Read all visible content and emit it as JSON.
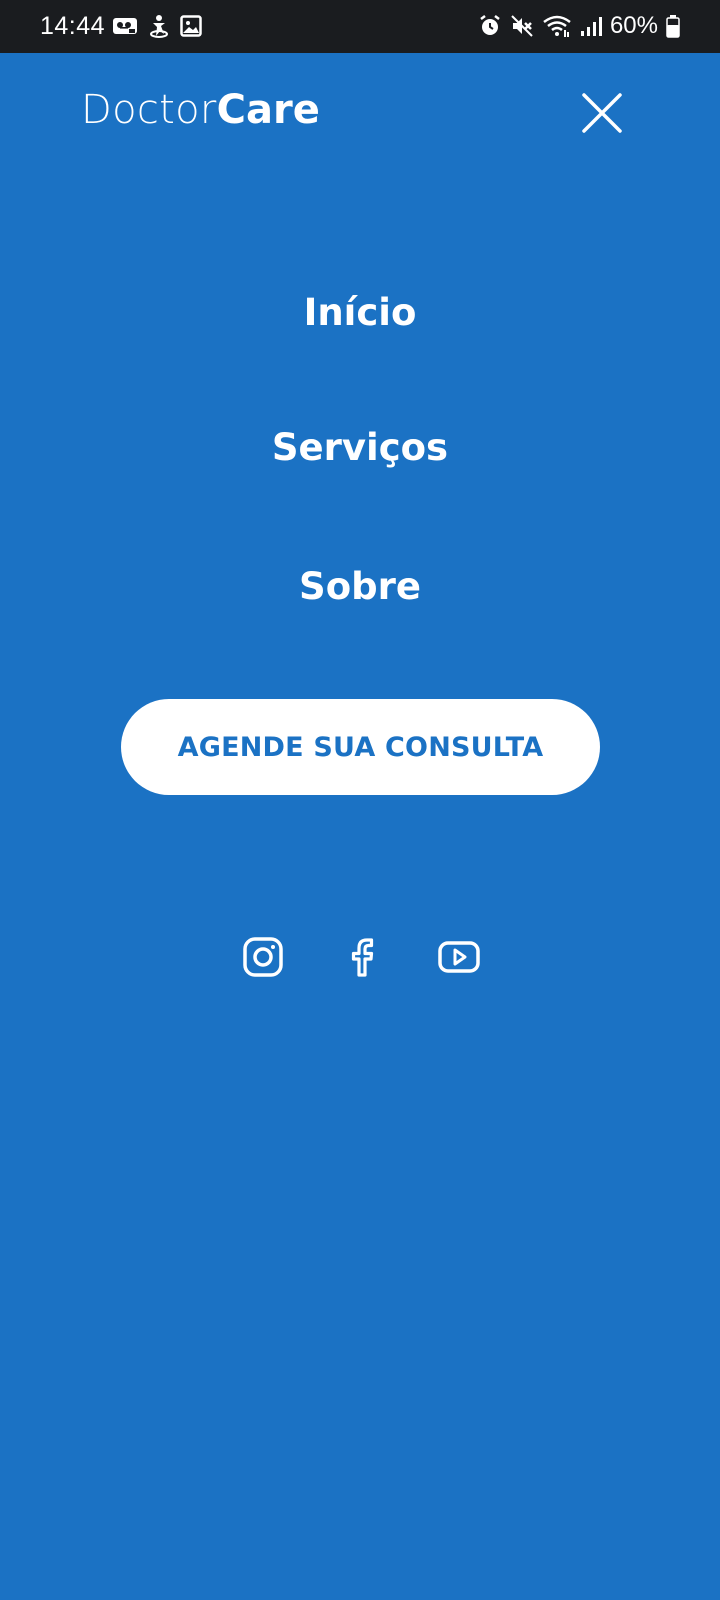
{
  "status_bar": {
    "time": "14:44",
    "battery_percent": "60%",
    "left_icons": [
      "voicemail-icon",
      "accessibility-icon",
      "gallery-icon"
    ],
    "right_icons": [
      "alarm-icon",
      "mute-icon",
      "wifi-icon",
      "signal-icon",
      "battery-icon"
    ]
  },
  "header": {
    "brand_light": "Doctor",
    "brand_bold": "Care",
    "close_icon": "close-icon"
  },
  "nav": {
    "items": [
      {
        "label": "Início"
      },
      {
        "label": "Serviços"
      },
      {
        "label": "Sobre"
      }
    ]
  },
  "cta": {
    "label": "AGENDE SUA CONSULTA"
  },
  "social": {
    "icons": [
      "instagram-icon",
      "facebook-icon",
      "youtube-icon"
    ]
  },
  "colors": {
    "background": "#1b72c4",
    "status_bar": "#1a1c1f",
    "text": "#ffffff",
    "cta_text": "#1b72c4"
  }
}
